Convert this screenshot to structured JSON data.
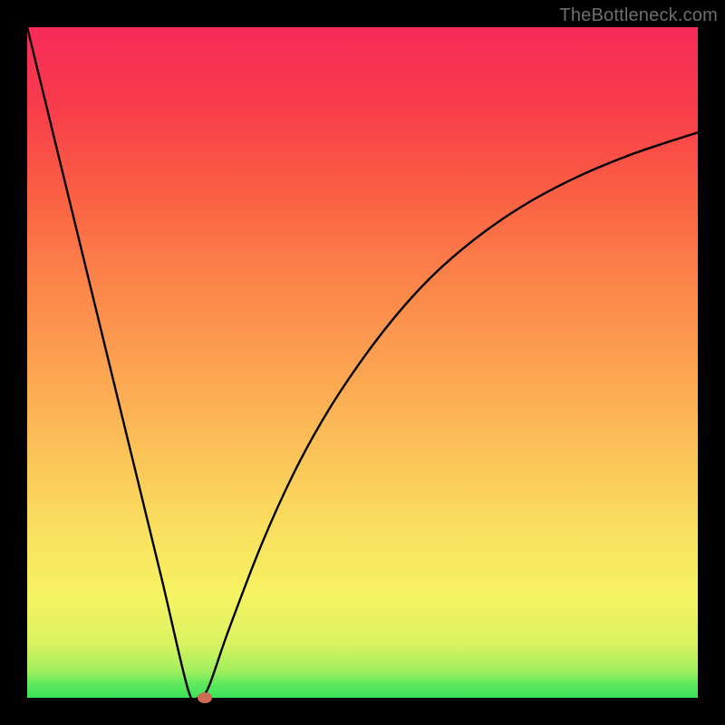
{
  "watermark": "TheBottleneck.com",
  "colors": {
    "frame": "#000000",
    "curve": "#000000",
    "marker": "#cf6a56"
  },
  "chart_data": {
    "type": "line",
    "title": "",
    "xlabel": "",
    "ylabel": "",
    "xlim": [
      0,
      100
    ],
    "ylim": [
      0,
      100
    ],
    "grid": false,
    "legend": false,
    "series": [
      {
        "name": "bottleneck-curve",
        "x": [
          0,
          5,
          10,
          15,
          20,
          24,
          25.5,
          27,
          30,
          35,
          40,
          45,
          50,
          55,
          60,
          65,
          70,
          75,
          80,
          85,
          90,
          95,
          100
        ],
        "values": [
          100,
          79.5,
          59,
          38.5,
          18,
          1.2,
          0,
          1.5,
          10,
          23,
          34,
          43,
          50.5,
          57,
          62.5,
          67,
          70.8,
          74,
          76.7,
          79,
          81,
          82.7,
          84.3
        ]
      }
    ],
    "marker": {
      "x": 26.5,
      "y": 0
    },
    "background_gradient": {
      "stops": [
        {
          "pos": 0,
          "color": "#3be25a"
        },
        {
          "pos": 15,
          "color": "#f6f362"
        },
        {
          "pos": 50,
          "color": "#fca652"
        },
        {
          "pos": 100,
          "color": "#f72a58"
        }
      ]
    }
  }
}
